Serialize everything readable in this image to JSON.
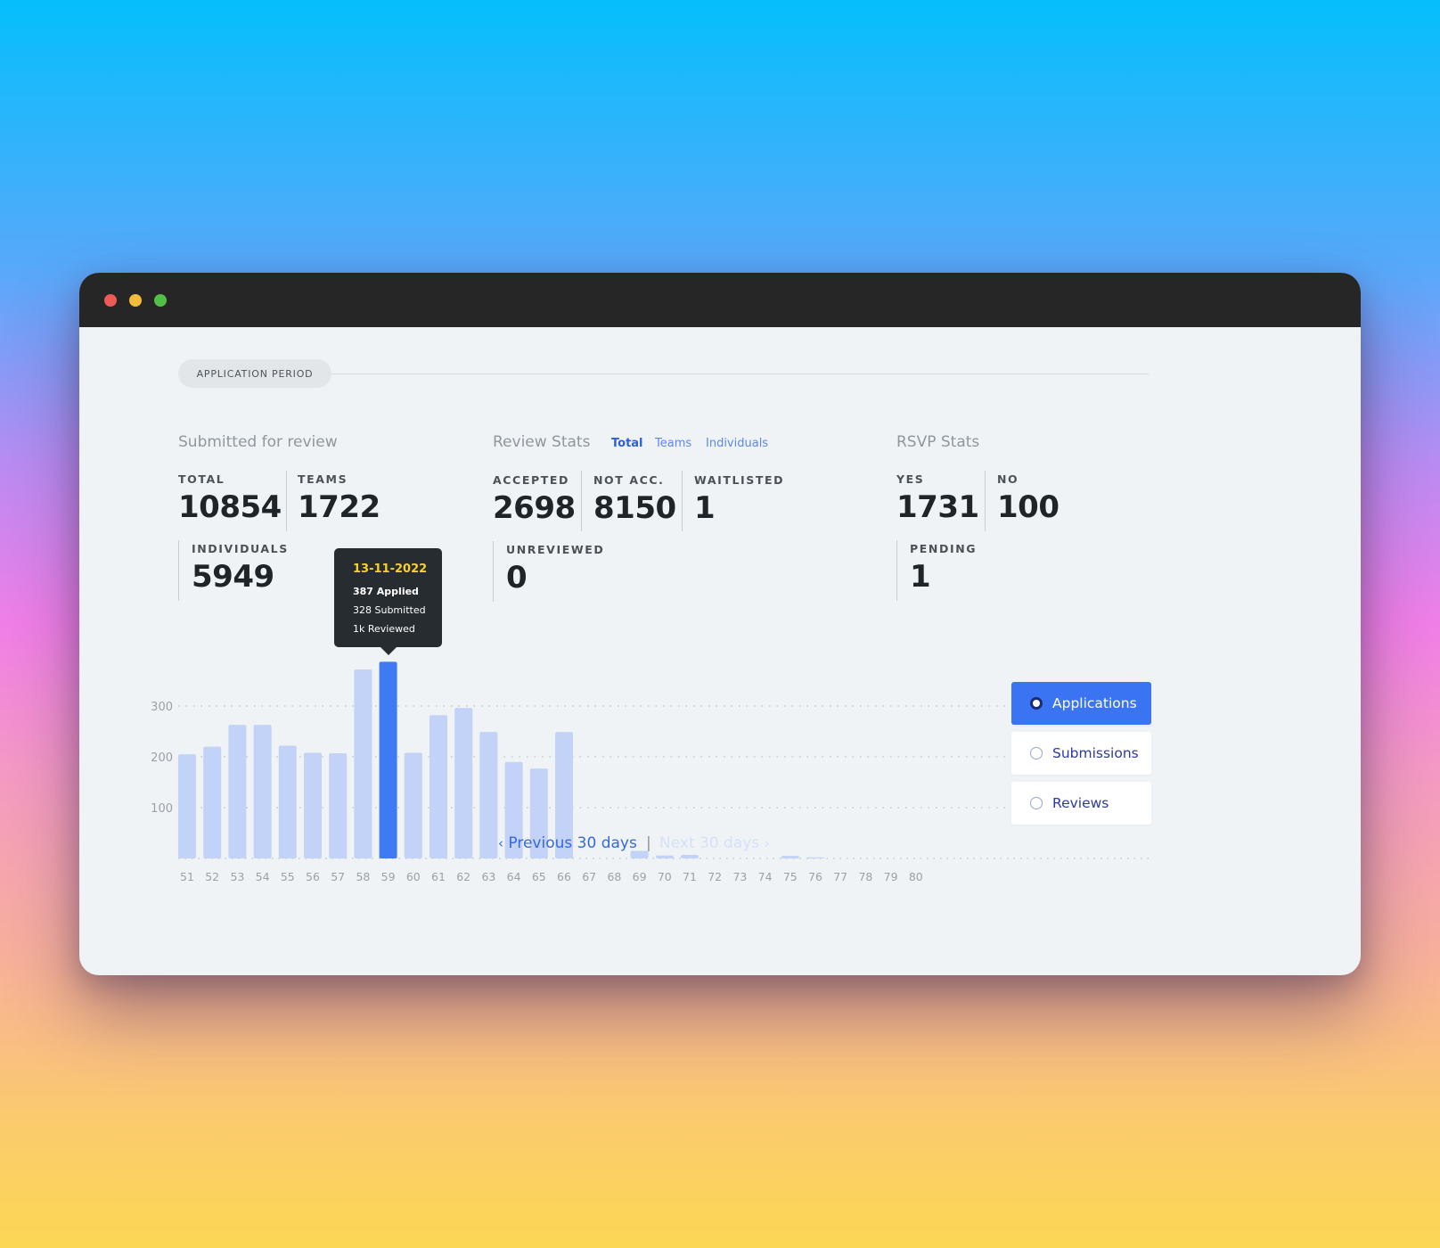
{
  "window": {
    "controls": [
      "close",
      "minimize",
      "maximize"
    ]
  },
  "period_label": "APPLICATION PERIOD",
  "submitted": {
    "title": "Submitted for review",
    "total_label": "TOTAL",
    "total": "10854",
    "teams_label": "TEAMS",
    "teams": "1722",
    "individuals_label": "INDIVIDUALS",
    "individuals": "5949"
  },
  "review": {
    "title": "Review Stats",
    "filters": [
      "Total",
      "Teams",
      "Individuals"
    ],
    "active_filter": "Total",
    "accepted_label": "ACCEPTED",
    "accepted": "2698",
    "not_accepted_label": "NOT ACC.",
    "not_accepted": "8150",
    "waitlisted_label": "WAITLISTED",
    "waitlisted": "1",
    "unreviewed_label": "UNREVIEWED",
    "unreviewed": "0"
  },
  "rsvp": {
    "title": "RSVP Stats",
    "yes_label": "YES",
    "yes": "1731",
    "no_label": "NO",
    "no": "100",
    "pending_label": "PENDING",
    "pending": "1"
  },
  "tooltip": {
    "date": "13-11-2022",
    "applied": "387 Applied",
    "submitted": "328 Submitted",
    "reviewed": "1k Reviewed"
  },
  "chart_data": {
    "type": "bar",
    "categories": [
      "51",
      "52",
      "53",
      "54",
      "55",
      "56",
      "57",
      "58",
      "59",
      "60",
      "61",
      "62",
      "63",
      "64",
      "65",
      "66",
      "67",
      "68",
      "69",
      "70",
      "71",
      "72",
      "73",
      "74",
      "75",
      "76",
      "77",
      "78",
      "79",
      "80"
    ],
    "values": [
      205,
      220,
      263,
      263,
      222,
      208,
      207,
      372,
      387,
      208,
      282,
      296,
      249,
      190,
      177,
      249,
      0,
      0,
      15,
      6,
      7,
      0,
      0,
      0,
      5,
      2,
      0,
      0,
      0,
      0
    ],
    "highlight_category": "59",
    "y_ticks": [
      100,
      200,
      300
    ],
    "ylim": [
      0,
      400
    ],
    "grid": "dotted horizontal",
    "colors": {
      "bar": "#c3d2f7",
      "highlight": "#3f7af3",
      "tick": "#9aa1a7"
    }
  },
  "legend": {
    "options": [
      "Applications",
      "Submissions",
      "Reviews"
    ],
    "selected": "Applications"
  },
  "pager": {
    "prev": "Previous 30 days",
    "separator": "|",
    "next": "Next 30 days"
  }
}
